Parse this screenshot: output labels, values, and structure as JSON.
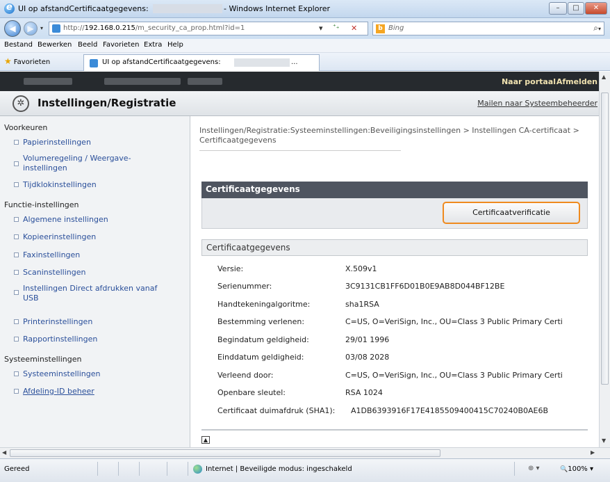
{
  "window": {
    "title_prefix": "UI op afstandCertificaatgegevens:",
    "title_suffix": "- Windows Internet Explorer",
    "minimize": "–",
    "maximize": "□",
    "close": "✕"
  },
  "address": {
    "back": "◀",
    "forward": "▶",
    "url_prefix": "http://",
    "url_host": "192.168.0.215",
    "url_path": "/m_security_ca_prop.html?id=1",
    "dropdown": "▾",
    "refresh": "⁺₊",
    "stop": "✕",
    "search_placeholder": "Bing",
    "search_go": "⌕",
    "search_drop": "▾"
  },
  "menu": [
    "Bestand",
    "Bewerken",
    "Beeld",
    "Favorieten",
    "Extra",
    "Help"
  ],
  "favbar": {
    "favorites_label": "Favorieten",
    "tab_label": "UI op afstandCertificaatgegevens:",
    "tab_ellipsis": "..."
  },
  "topbar": {
    "portal": "Naar portaal",
    "logout": "Afmelden"
  },
  "header": {
    "title": "Instellingen/Registratie",
    "mail_link": "Mailen naar Systeembeheerder"
  },
  "sidebar": {
    "sections": [
      {
        "title": "Voorkeuren",
        "items": [
          "Papierinstellingen",
          "Volumeregeling / Weergave-instellingen",
          "Tijdklokinstellingen"
        ]
      },
      {
        "title": "Functie-instellingen",
        "items": [
          "Algemene instellingen",
          "Kopieerinstellingen",
          "Faxinstellingen",
          "Scaninstellingen",
          "Instellingen Direct afdrukken vanaf USB",
          "Printerinstellingen",
          "Rapportinstellingen"
        ]
      },
      {
        "title": "Systeeminstellingen",
        "items": [
          "Systeeminstellingen",
          "Afdeling-ID beheer"
        ]
      }
    ]
  },
  "main": {
    "breadcrumb": "Instellingen/Registratie:Systeeminstellingen:Beveiligingsinstellingen > Instellingen CA-certificaat > Certificaatgegevens",
    "panel_title": "Certificaatgegevens",
    "verify_button": "Certificaatverificatie",
    "sub_title": "Certificaatgegevens",
    "rows": [
      {
        "label": "Versie:",
        "value": "X.509v1"
      },
      {
        "label": "Serienummer:",
        "value": "3C9131CB1FF6D01B0E9AB8D044BF12BE"
      },
      {
        "label": "Handtekeningalgoritme:",
        "value": "sha1RSA"
      },
      {
        "label": "Bestemming verlenen:",
        "value": "C=US, O=VeriSign, Inc., OU=Class 3 Public Primary Certi"
      },
      {
        "label": "Begindatum geldigheid:",
        "value": "29/01 1996"
      },
      {
        "label": "Einddatum geldigheid:",
        "value": "03/08 2028"
      },
      {
        "label": "Verleend door:",
        "value": "C=US, O=VeriSign, Inc., OU=Class 3 Public Primary Certi"
      },
      {
        "label": "Openbare sleutel:",
        "value": "RSA 1024"
      },
      {
        "label": "Certificaat duimafdruk (SHA1):",
        "value": "A1DB6393916F17E4185509400415C70240B0AE6B"
      }
    ]
  },
  "status": {
    "left": "Gereed",
    "zone": "Internet | Beveiligde modus: ingeschakeld",
    "zoom": "100%",
    "zoom_icon": "🔍",
    "zoom_drop": "▾"
  }
}
